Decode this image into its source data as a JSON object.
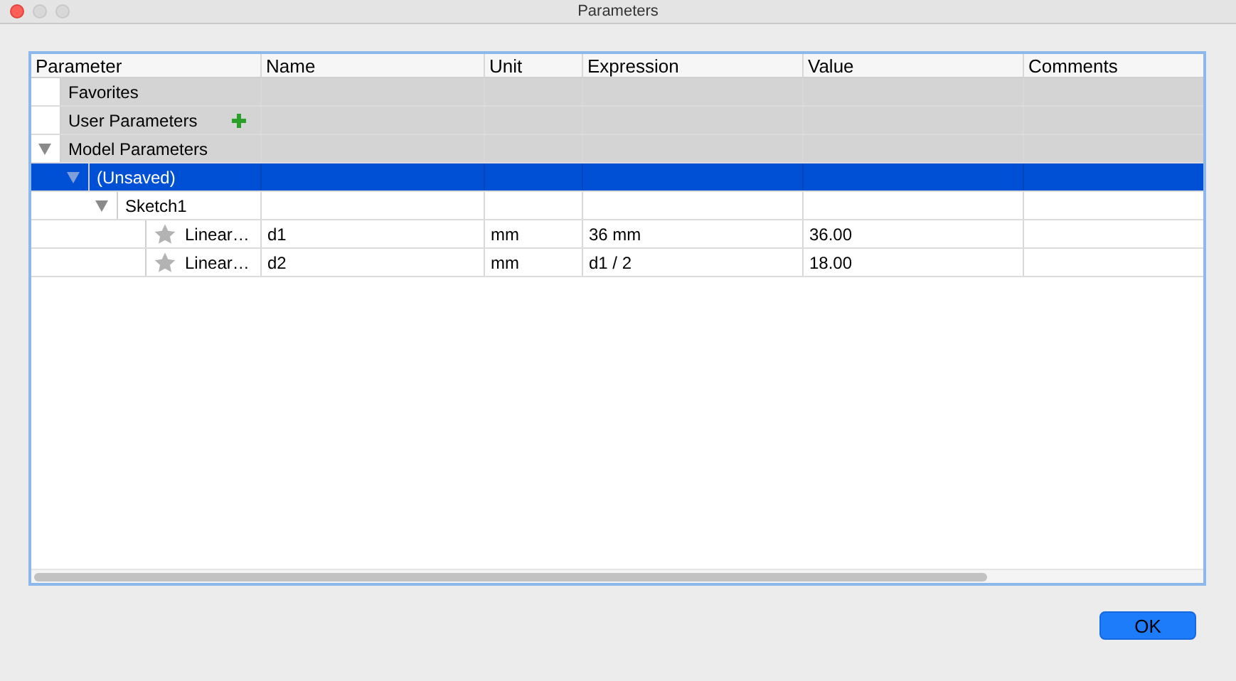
{
  "window": {
    "title": "Parameters"
  },
  "table": {
    "columns": [
      "Parameter",
      "Name",
      "Unit",
      "Expression",
      "Value",
      "Comments"
    ],
    "tree": [
      {
        "label": "Favorites",
        "kind": "group",
        "selected": false
      },
      {
        "label": "User Parameters",
        "kind": "group",
        "addable": true,
        "selected": false
      },
      {
        "label": "Model Parameters",
        "kind": "group",
        "expanded": true,
        "selected": false,
        "children": [
          {
            "label": "(Unsaved)",
            "kind": "node",
            "expanded": true,
            "selected": true,
            "children": [
              {
                "label": "Sketch1",
                "kind": "node",
                "expanded": true,
                "selected": false,
                "children": [
                  {
                    "label": "Linear…",
                    "kind": "parameter",
                    "selected": false,
                    "name": "d1",
                    "unit": "mm",
                    "expression": "36 mm",
                    "value": "36.00"
                  },
                  {
                    "label": "Linear…",
                    "kind": "parameter",
                    "selected": false,
                    "name": "d2",
                    "unit": "mm",
                    "expression": "d1 / 2",
                    "value": "18.00"
                  }
                ]
              }
            ]
          }
        ]
      }
    ]
  },
  "buttons": [
    "OK"
  ]
}
